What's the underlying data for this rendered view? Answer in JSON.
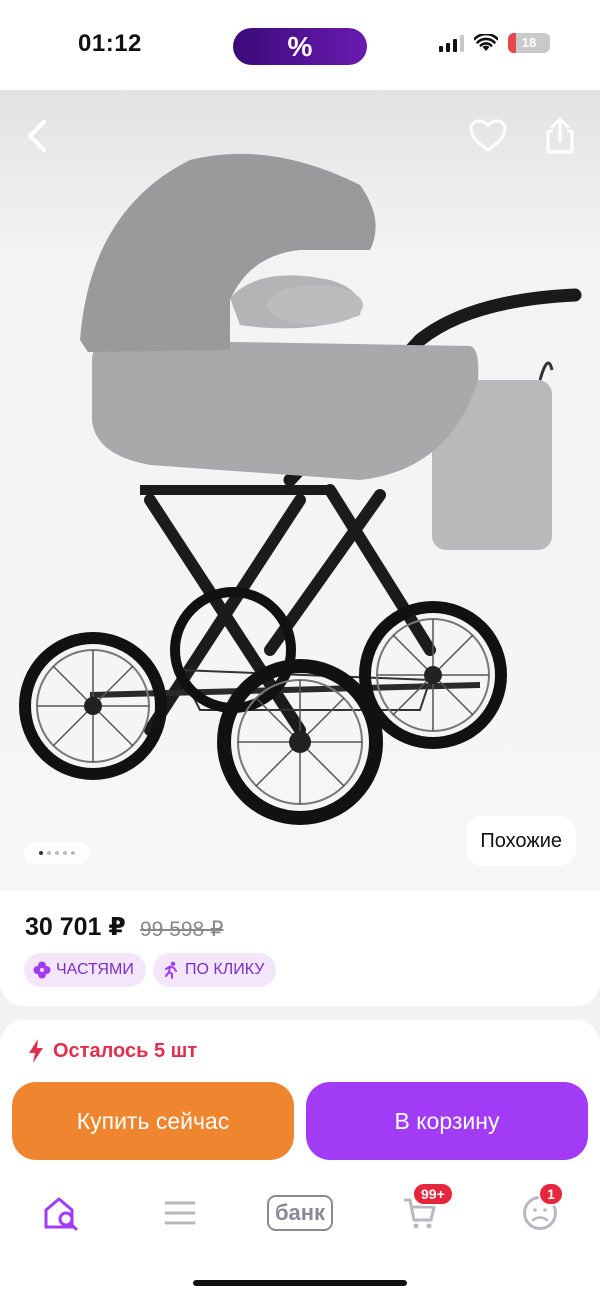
{
  "status_bar": {
    "time": "01:12",
    "promo_symbol": "%",
    "battery_level": "18",
    "battery_fraction": 0.18
  },
  "product": {
    "image_alt": "Grey baby stroller with bassinet and bag",
    "gallery_pages": 5,
    "gallery_active": 0,
    "similar_label": "Похожие",
    "price": "30 701 ₽",
    "old_price": "99 598 ₽",
    "chips": [
      {
        "label": "ЧАСТЯМИ",
        "icon": "clover-icon"
      },
      {
        "label": "ПО КЛИКУ",
        "icon": "running-person-icon"
      }
    ]
  },
  "actions": {
    "stock_text": "Осталось 5 шт",
    "buy_now_label": "Купить сейчас",
    "add_to_cart_label": "В корзину"
  },
  "tabbar": {
    "bank_label": "банк",
    "cart_badge": "99+",
    "profile_badge": "1"
  },
  "colors": {
    "accent_purple": "#a23bf5",
    "buy_orange": "#f0852f",
    "alert_red": "#e0304d",
    "badge_red": "#e5273d"
  }
}
